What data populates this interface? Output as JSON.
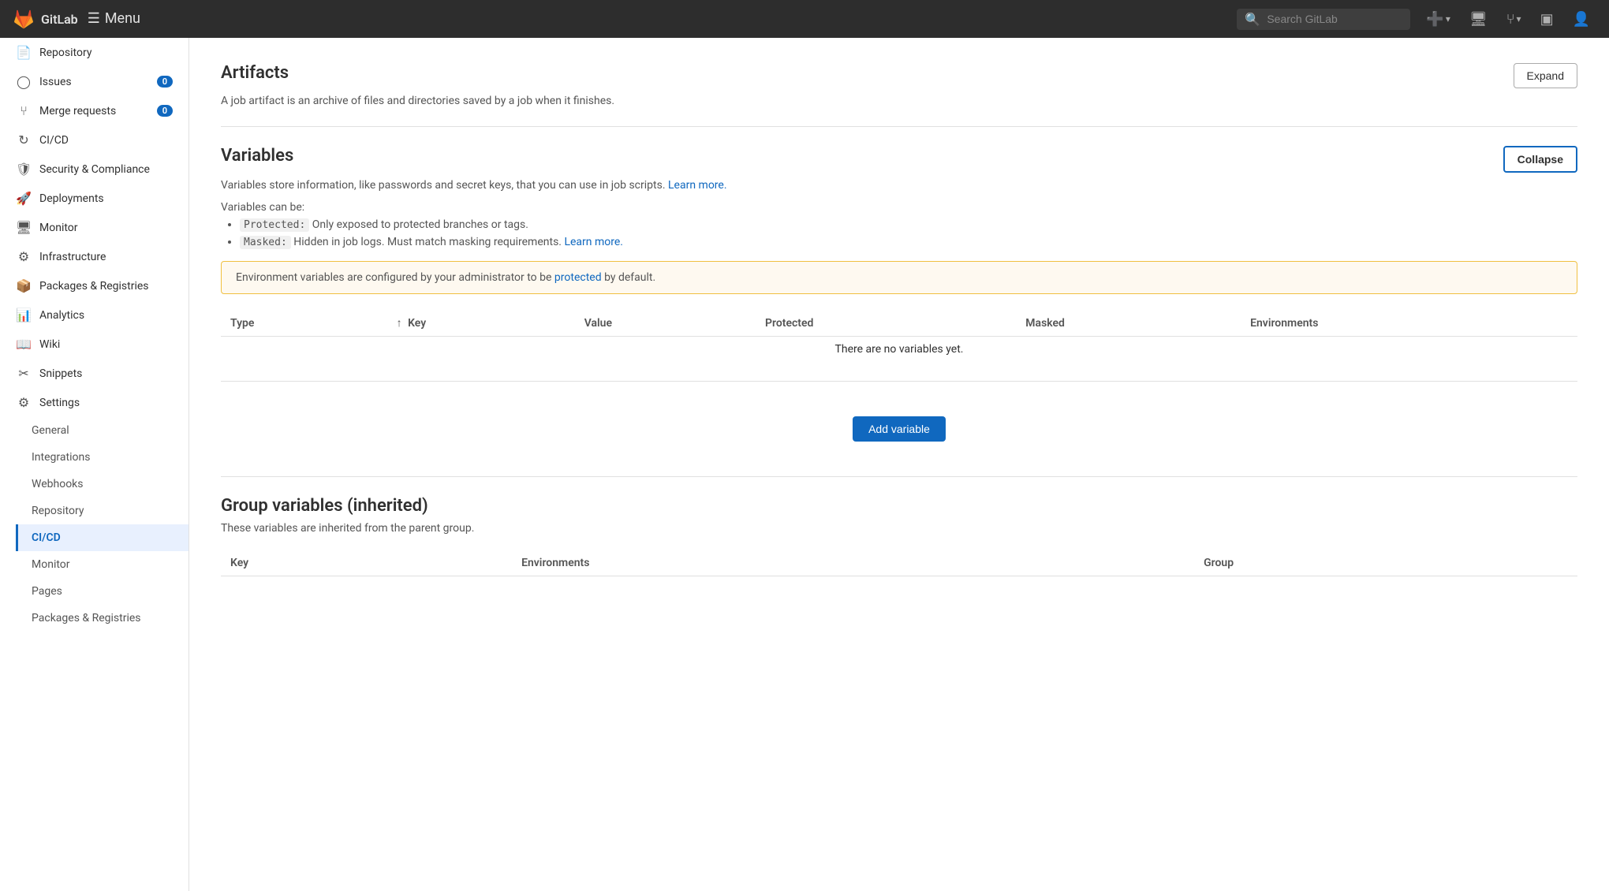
{
  "topnav": {
    "logo_alt": "GitLab",
    "menu_label": "Menu",
    "search_placeholder": "Search GitLab",
    "new_icon": "➕",
    "merge_icon": "⑂",
    "issues_icon": "▣",
    "profile_icon": "👤"
  },
  "sidebar": {
    "items": [
      {
        "id": "repository",
        "label": "Repository",
        "icon": "📄",
        "badge": null
      },
      {
        "id": "issues",
        "label": "Issues",
        "icon": "○",
        "badge": "0"
      },
      {
        "id": "merge-requests",
        "label": "Merge requests",
        "icon": "⑂",
        "badge": "0"
      },
      {
        "id": "cicd",
        "label": "CI/CD",
        "icon": "↻",
        "badge": null
      },
      {
        "id": "security",
        "label": "Security & Compliance",
        "icon": "🛡",
        "badge": null
      },
      {
        "id": "deployments",
        "label": "Deployments",
        "icon": "🚀",
        "badge": null
      },
      {
        "id": "monitor",
        "label": "Monitor",
        "icon": "🖥",
        "badge": null
      },
      {
        "id": "infrastructure",
        "label": "Infrastructure",
        "icon": "⚙",
        "badge": null
      },
      {
        "id": "packages",
        "label": "Packages & Registries",
        "icon": "📦",
        "badge": null
      },
      {
        "id": "analytics",
        "label": "Analytics",
        "icon": "📊",
        "badge": null
      },
      {
        "id": "wiki",
        "label": "Wiki",
        "icon": "📖",
        "badge": null
      },
      {
        "id": "snippets",
        "label": "Snippets",
        "icon": "✂",
        "badge": null
      },
      {
        "id": "settings",
        "label": "Settings",
        "icon": "⚙",
        "badge": null
      }
    ],
    "sub_items": [
      {
        "id": "general",
        "label": "General"
      },
      {
        "id": "integrations",
        "label": "Integrations"
      },
      {
        "id": "webhooks",
        "label": "Webhooks"
      },
      {
        "id": "repository-sub",
        "label": "Repository"
      },
      {
        "id": "cicd-sub",
        "label": "CI/CD",
        "active": true
      },
      {
        "id": "monitor-sub",
        "label": "Monitor"
      },
      {
        "id": "pages",
        "label": "Pages"
      },
      {
        "id": "packages-sub",
        "label": "Packages & Registries"
      }
    ]
  },
  "artifacts": {
    "title": "Artifacts",
    "description": "A job artifact is an archive of files and directories saved by a job when it finishes.",
    "expand_label": "Expand"
  },
  "variables": {
    "title": "Variables",
    "collapse_label": "Collapse",
    "description": "Variables store information, like passwords and secret keys, that you can use in job scripts.",
    "learn_more_text": "Learn more.",
    "learn_more_url": "#",
    "can_be_label": "Variables can be:",
    "bullet1_code": "Protected:",
    "bullet1_text": " Only exposed to protected branches or tags.",
    "bullet2_code": "Masked:",
    "bullet2_text": " Hidden in job logs. Must match masking requirements.",
    "learn_more2_text": "Learn more.",
    "learn_more2_url": "#",
    "banner_text": "Environment variables are configured by your administrator to be",
    "banner_link_text": "protected",
    "banner_link_url": "#",
    "banner_suffix": " by default.",
    "col_type": "Type",
    "col_key": "Key",
    "col_value": "Value",
    "col_protected": "Protected",
    "col_masked": "Masked",
    "col_environments": "Environments",
    "no_vars_text": "There are no variables yet.",
    "add_variable_label": "Add variable"
  },
  "group_variables": {
    "title": "Group variables (inherited)",
    "description": "These variables are inherited from the parent group.",
    "col_key": "Key",
    "col_environments": "Environments",
    "col_group": "Group"
  }
}
